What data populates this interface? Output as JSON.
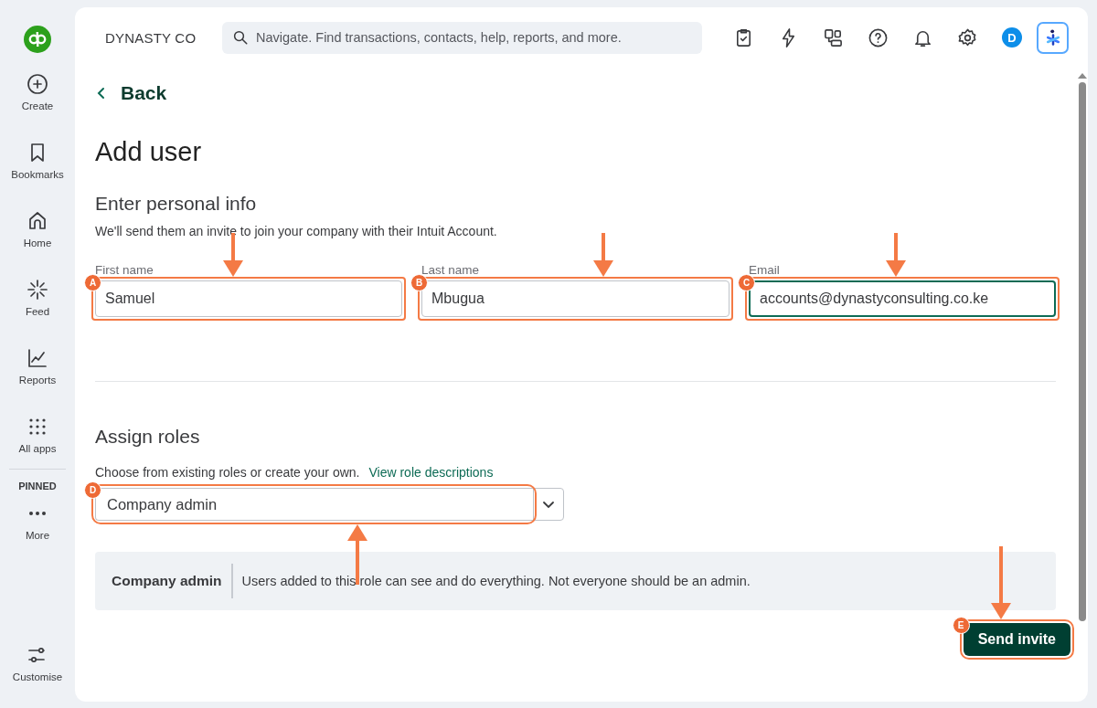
{
  "sidebar": {
    "items": [
      {
        "label": "Create",
        "kind": "create"
      },
      {
        "label": "Bookmarks",
        "kind": "bookmark"
      },
      {
        "label": "Home",
        "kind": "home"
      },
      {
        "label": "Feed",
        "kind": "feed"
      },
      {
        "label": "Reports",
        "kind": "reports"
      },
      {
        "label": "All apps",
        "kind": "apps"
      }
    ],
    "pinned_heading": "PINNED",
    "pinned": [
      {
        "label": "More",
        "kind": "more"
      }
    ],
    "footer": {
      "label": "Customise",
      "kind": "customise"
    }
  },
  "header": {
    "company": "DYNASTY CO",
    "search": {
      "placeholder": "Navigate. Find transactions, contacts, help, reports, and more."
    },
    "avatar": "D"
  },
  "page": {
    "back": "Back",
    "title": "Add user",
    "personal": {
      "heading": "Enter personal info",
      "description": "We'll send them an invite to join your company with their Intuit Account.",
      "fields": [
        {
          "label": "First name",
          "value": "Samuel",
          "focused": false,
          "callout": {
            "letter": "A",
            "kind": "down"
          }
        },
        {
          "label": "Last name",
          "value": "Mbugua",
          "focused": false,
          "callout": {
            "letter": "B",
            "kind": "down"
          }
        },
        {
          "label": "Email",
          "value": "accounts@dynastyconsulting.co.ke",
          "focused": true,
          "callout": {
            "letter": "C",
            "kind": "down"
          }
        }
      ]
    },
    "roles": {
      "heading": "Assign roles",
      "description": "Choose from existing roles or create your own.",
      "link": "View role descriptions",
      "dropdown": {
        "value": "Company admin",
        "callout": {
          "letter": "D",
          "kind": "up"
        }
      },
      "info": {
        "name": "Company admin",
        "text": "Users added to this role can see and do everything. Not everyone should be an admin."
      }
    },
    "send_button": {
      "label": "Send invite",
      "callout": {
        "letter": "E",
        "kind": "down"
      }
    }
  }
}
